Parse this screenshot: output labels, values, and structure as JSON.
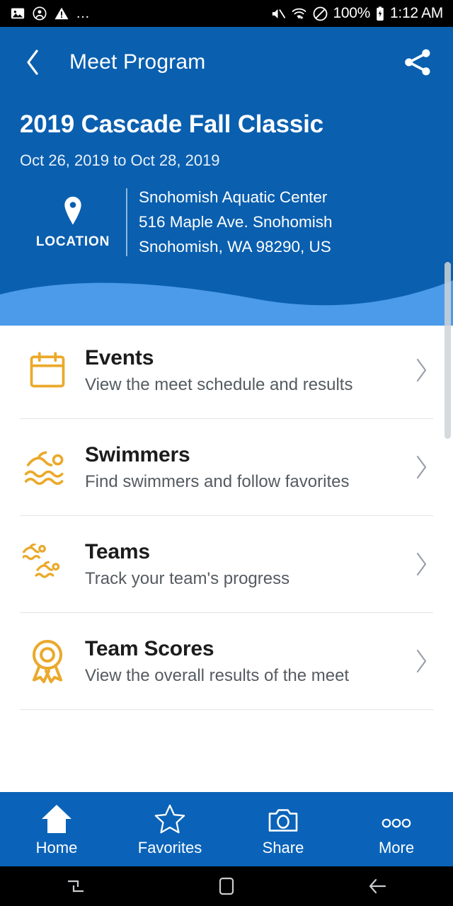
{
  "status_bar": {
    "left_icons": [
      "image-icon",
      "account-icon",
      "warning-icon",
      "overflow-dots-icon"
    ],
    "right_icons": [
      "mute-icon",
      "wifi-icon",
      "do-not-disturb-icon",
      "battery-icon"
    ],
    "battery_percent": "100%",
    "clock": "1:12 AM"
  },
  "app_bar": {
    "back_icon": "chevron-left-icon",
    "title": "Meet Program",
    "share_icon": "share-icon"
  },
  "meet": {
    "title": "2019 Cascade Fall Classic",
    "dates": "Oct 26, 2019 to Oct 28, 2019",
    "location": {
      "icon": "map-pin-icon",
      "label": "LOCATION",
      "line1": "Snohomish Aquatic Center",
      "line2": "516 Maple Ave. Snohomish",
      "line3": "Snohomish, WA 98290, US"
    }
  },
  "menu": {
    "items": [
      {
        "icon": "calendar-icon",
        "title": "Events",
        "subtitle": "View the meet schedule and results",
        "chevron": "chevron-right-icon"
      },
      {
        "icon": "swimmer-icon",
        "title": "Swimmers",
        "subtitle": "Find swimmers and follow favorites",
        "chevron": "chevron-right-icon"
      },
      {
        "icon": "two-swimmers-icon",
        "title": "Teams",
        "subtitle": "Track your team's progress",
        "chevron": "chevron-right-icon"
      },
      {
        "icon": "award-ribbon-icon",
        "title": "Team Scores",
        "subtitle": "View the overall results of the meet",
        "chevron": "chevron-right-icon"
      }
    ]
  },
  "tab_bar": {
    "tabs": [
      {
        "icon": "home-icon",
        "label": "Home"
      },
      {
        "icon": "star-icon",
        "label": "Favorites"
      },
      {
        "icon": "camera-icon",
        "label": "Share"
      },
      {
        "icon": "more-dots-icon",
        "label": "More"
      }
    ]
  },
  "android_nav": {
    "buttons": [
      "recents-icon",
      "home-square-icon",
      "back-arrow-icon"
    ]
  },
  "colors": {
    "header_blue": "#0A5FAF",
    "tabbar_blue": "#0A63B8",
    "wave_light_blue": "#4B9BEA",
    "accent_gold": "#EBA92B",
    "title_dark": "#1C1C1C",
    "subtitle_gray": "#555B60"
  }
}
